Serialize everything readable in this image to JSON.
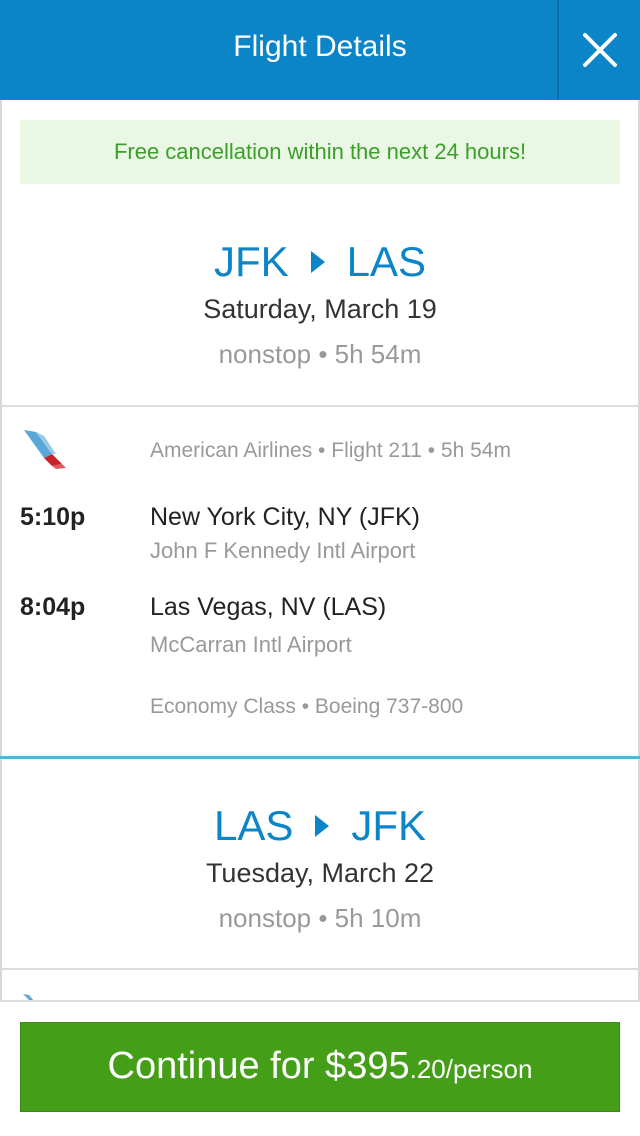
{
  "header": {
    "title": "Flight Details",
    "close_icon": "close-icon"
  },
  "notice": {
    "text": "Free cancellation within the next 24 hours!"
  },
  "outbound": {
    "origin": "JFK",
    "destination": "LAS",
    "date": "Saturday, March 19",
    "meta": "nonstop • 5h 54m",
    "segment": {
      "airline_logo": "american-airlines-logo",
      "info": "American Airlines • Flight 211 •  5h 54m",
      "depart_time": "5:10p",
      "depart_city": "New York City, NY (JFK)",
      "depart_airport": "John F Kennedy Intl Airport",
      "arrive_time": "8:04p",
      "arrive_city": "Las Vegas, NV (LAS)",
      "arrive_airport": "McCarran Intl Airport",
      "cabin": "Economy Class  •  Boeing 737-800"
    }
  },
  "return": {
    "origin": "LAS",
    "destination": "JFK",
    "date": "Tuesday, March 22",
    "meta": "nonstop • 5h 10m"
  },
  "footer": {
    "button_main": "Continue for $395",
    "button_cents": ".20/person"
  },
  "colors": {
    "header": "#0b85c8",
    "accent": "#0b85c8",
    "notice_bg": "#e9f7e4",
    "notice_text": "#3ba02a",
    "cta": "#449e17"
  }
}
